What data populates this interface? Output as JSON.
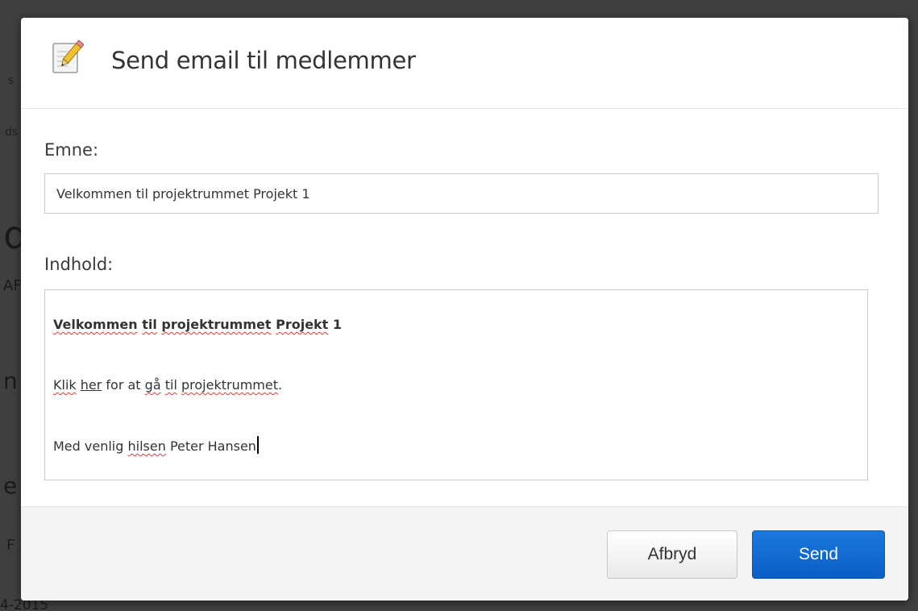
{
  "background": {
    "fragments": [
      "s",
      "ds",
      "d",
      "AF",
      "n",
      "e",
      "F",
      "4-2015"
    ]
  },
  "dialog": {
    "title": "Send email til medlemmer",
    "icon": "notepad-pencil-icon"
  },
  "form": {
    "subject_label": "Emne:",
    "subject_value": "Velkommen til projektrummet Projekt 1",
    "content_label": "Indhold:",
    "content": {
      "heading_words": [
        "Velkommen",
        "til",
        "projektrummet",
        "Projekt",
        "1"
      ],
      "line2": {
        "w1": "Klik",
        "link": "her",
        "w2": "for at",
        "w3": "gå",
        "w4": "til",
        "w5": "projektrummet",
        "w6": "."
      },
      "line3": {
        "w1": "Med venlig",
        "w2": "hilsen",
        "w3": "Peter Hansen"
      }
    }
  },
  "footer": {
    "cancel_label": "Afbryd",
    "send_label": "Send"
  },
  "colors": {
    "primary": "#0a66cc",
    "spellcheck": "#e53b3b"
  }
}
